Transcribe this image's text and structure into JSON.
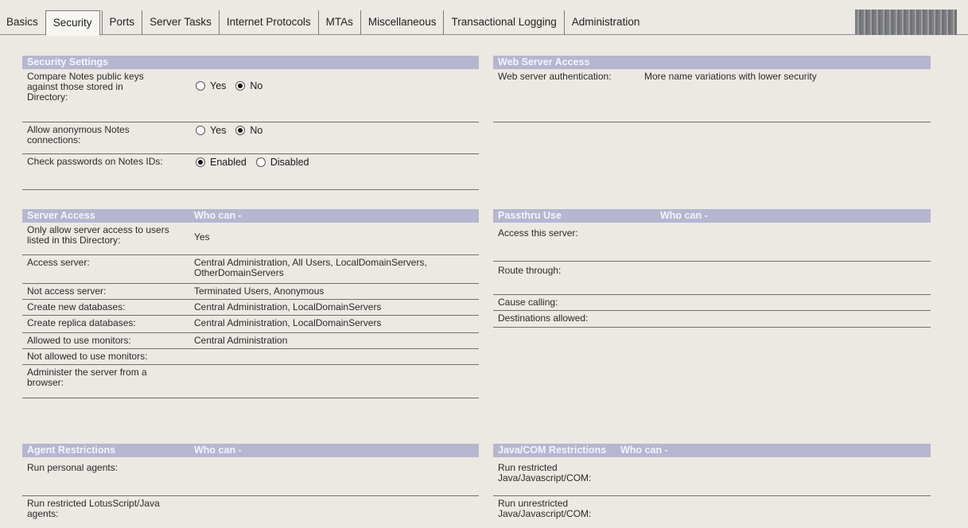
{
  "tabs": [
    {
      "label": "Basics"
    },
    {
      "label": "Security"
    },
    {
      "label": "Ports"
    },
    {
      "label": "Server Tasks"
    },
    {
      "label": "Internet Protocols"
    },
    {
      "label": "MTAs"
    },
    {
      "label": "Miscellaneous"
    },
    {
      "label": "Transactional Logging"
    },
    {
      "label": "Administration"
    }
  ],
  "active_tab": "Security",
  "security_settings": {
    "header": "Security Settings",
    "compare_keys": {
      "label": "Compare Notes public keys against those stored in Directory:",
      "opt_yes": "Yes",
      "opt_no": "No",
      "selected": "No"
    },
    "anonymous": {
      "label": "Allow anonymous Notes connections:",
      "opt_yes": "Yes",
      "opt_no": "No",
      "selected": "No"
    },
    "check_passwords": {
      "label": "Check passwords on Notes IDs:",
      "opt_enabled": "Enabled",
      "opt_disabled": "Disabled",
      "selected": "Enabled"
    }
  },
  "web_server_access": {
    "header": "Web Server Access",
    "auth_label": "Web server authentication:",
    "auth_value": "More name variations with lower security"
  },
  "server_access": {
    "header": "Server Access",
    "sub": "Who can -",
    "rows": [
      {
        "label": "Only allow server access to users listed in this Directory:",
        "value": "Yes"
      },
      {
        "label": "Access server:",
        "value": "Central Administration, All Users, LocalDomainServers, OtherDomainServers"
      },
      {
        "label": "Not access server:",
        "value": "Terminated Users, Anonymous"
      },
      {
        "label": "Create new databases:",
        "value": "Central Administration, LocalDomainServers"
      },
      {
        "label": "Create replica databases:",
        "value": "Central Administration, LocalDomainServers"
      },
      {
        "label": "Allowed to use monitors:",
        "value": "Central Administration"
      },
      {
        "label": "Not allowed to use monitors:",
        "value": ""
      },
      {
        "label": "Administer the server from a browser:",
        "value": ""
      }
    ]
  },
  "passthru_use": {
    "header": "Passthru Use",
    "sub": "Who can -",
    "rows": [
      {
        "label": "Access this server:",
        "value": ""
      },
      {
        "label": "Route through:",
        "value": ""
      },
      {
        "label": "Cause calling:",
        "value": ""
      },
      {
        "label": "Destinations allowed:",
        "value": ""
      }
    ]
  },
  "agent_restrictions": {
    "header": "Agent Restrictions",
    "sub": "Who can -",
    "rows": [
      {
        "label": "Run personal agents:",
        "value": ""
      },
      {
        "label": "Run restricted LotusScript/Java agents:",
        "value": ""
      }
    ]
  },
  "java_com": {
    "header": "Java/COM Restrictions",
    "sub": "Who can -",
    "rows": [
      {
        "label": "Run restricted Java/Javascript/COM:",
        "value": ""
      },
      {
        "label": "Run unrestricted Java/Javascript/COM:",
        "value": ""
      }
    ]
  }
}
